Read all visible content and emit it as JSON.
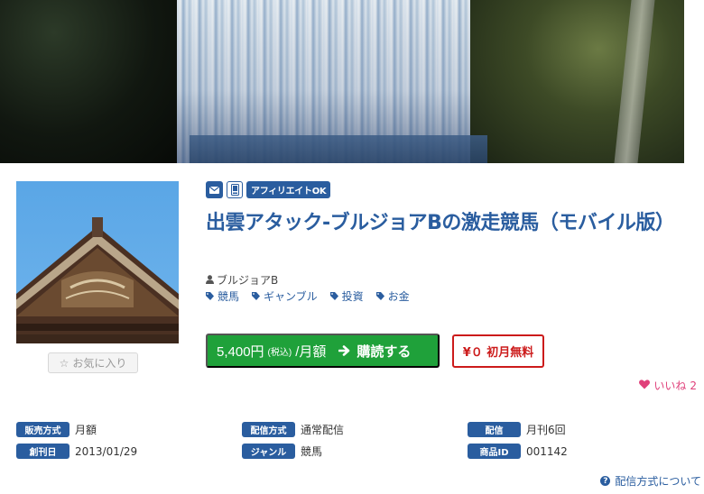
{
  "product": {
    "badges": {
      "mail_icon": "mail-icon",
      "mobile_icon": "mobile-icon",
      "affiliate": "アフィリエイトOK"
    },
    "title": "出雲アタック-ブルジョアBの激走競馬（モバイル版）",
    "author": "ブルジョアB",
    "tags": [
      "競馬",
      "ギャンブル",
      "投資",
      "お金"
    ],
    "favorite_label": "お気に入り"
  },
  "purchase": {
    "price": "5,400円",
    "tax_note": "(税込)",
    "period": "/月額",
    "action": "購読する",
    "first_month": "¥０ 初月無料"
  },
  "like": {
    "label": "いいね",
    "count": "2"
  },
  "info": {
    "sales_method": {
      "label": "販売方式",
      "value": "月額"
    },
    "publish_date": {
      "label": "創刊日",
      "value": "2013/01/29"
    },
    "delivery_method": {
      "label": "配信方式",
      "value": "通常配信"
    },
    "genre": {
      "label": "ジャンル",
      "value": "競馬"
    },
    "delivery": {
      "label": "配信",
      "value": "月刊6回"
    },
    "product_id": {
      "label": "商品ID",
      "value": "001142"
    }
  },
  "help": {
    "label": "配信方式について"
  },
  "colors": {
    "brand_blue": "#2a5d9f",
    "buy_green": "#1fa13a",
    "alert_red": "#cc1b1b",
    "like_pink": "#e0407a"
  }
}
